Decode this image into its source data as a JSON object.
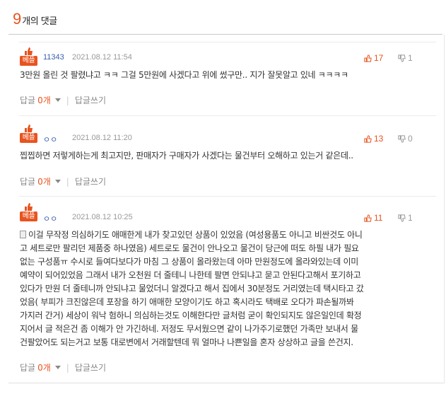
{
  "header": {
    "count": "9",
    "label": "개의 댓글"
  },
  "comments": [
    {
      "badge": "베플",
      "author": "11343",
      "date": "2021.08.12 11:54",
      "likes": "17",
      "dislikes": "1",
      "text": "3만원 올린 것 팔렸냐고 ㅋㅋ 그걸 5만원에 사겠다고 위에 썼구만.. 지가 잘못알고 있네 ㅋㅋㅋㅋ",
      "reply_label": "답글",
      "reply_count": "0개",
      "write_label": "답글쓰기"
    },
    {
      "badge": "베플",
      "author": "ㅇㅇ",
      "date": "2021.08.12 11:20",
      "likes": "13",
      "dislikes": "0",
      "text": "찝찝하면 저렇게하는게 최고지만, 판매자가 구매자가 사겠다는 물건부터 오해하고 있는거 같은데..",
      "reply_label": "답글",
      "reply_count": "0개",
      "write_label": "답글쓰기"
    },
    {
      "badge": "베플",
      "author": "ㅇㅇ",
      "date": "2021.08.12 10:25",
      "likes": "11",
      "dislikes": "1",
      "lines": [
        "이걸 무작정 의심하기도 애매한게 내가 찾고있던 상품이 있었음 (여성용품도 아니고 비싼것도 아니",
        "고 세트로만 팔리던 제품중 하나였음) 세트로도 물건이 안나오고 물건이 당근에 떠도 하필 내가 필요",
        "없는 구성품ㅠ 수시로 들여다보다가 마침 그 상품이 올라왔는데 아마 만원정도에 올라와있는데 이미",
        "예약이 되어있었음 그래서 내가 오천원 더 줄테니 나한테 팔면 안되냐고 묻고 안된다고해서 포기하고",
        "있다가 만원 더 줄테니까 안되냐고 물었더니 알겠다고 해서 집에서 30분정도 거리였는데 택시타고 갔",
        "었음( 부피가 크진않은데 포장을 하기 애매한 모양이기도 하고 혹시라도 택배로 오다가 파손될까봐",
        "가지러 간거) 세상이 워낙 험하니 의심하는것도 이해한다만 글처럼 굳이 확인되지도 않은일인데 확정",
        "지어서 글 적은건 좀 이해가 안 가긴하네. 저정도 무서웠으면 같이 나가주기로했던 가족만 보내서 물",
        "건팔았어도 되는거고 보통 대로변에서 거래할텐데 뭐 얼마나 나쁜일을 혼자 상상하고 글을 쓴건지."
      ],
      "reply_label": "답글",
      "reply_count": "0개",
      "write_label": "답글쓰기"
    }
  ],
  "colors": {
    "accent": "#e8531f",
    "author": "#3b5fb0"
  },
  "icons": {
    "badge_icon": "thumbs-up-icon",
    "like_icon": "thumbs-up-icon",
    "dislike_icon": "thumbs-down-icon",
    "attachment_icon": "document-icon"
  }
}
